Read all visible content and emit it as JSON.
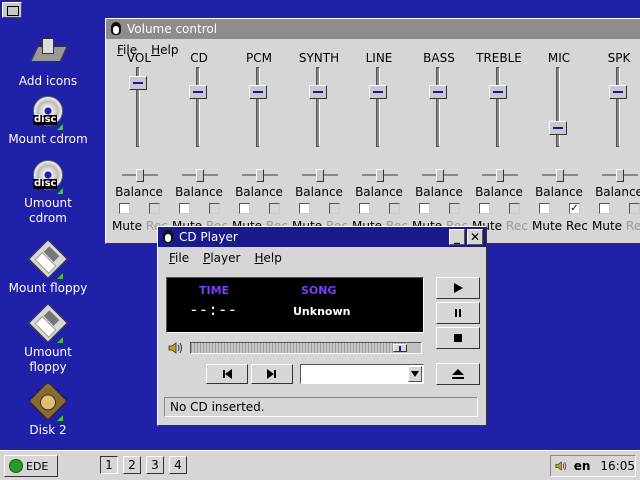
{
  "desktop": {
    "icons": [
      {
        "label": "Add icons",
        "icon": "add-icons-icon"
      },
      {
        "label": "Mount cdrom",
        "icon": "cdrom-icon"
      },
      {
        "label": "Umount\ncdrom",
        "icon": "cdrom-icon"
      },
      {
        "label": "Mount floppy",
        "icon": "floppy-icon"
      },
      {
        "label": "Umount\nfloppy",
        "icon": "floppy-icon"
      },
      {
        "label": "Disk 2",
        "icon": "disk-icon"
      }
    ],
    "cd_icon_text": "disc"
  },
  "volume": {
    "title": "Volume control",
    "menu": [
      "File",
      "Help"
    ],
    "balance_label": "Balance",
    "mute_label": "Mute",
    "rec_label": "Rec",
    "channels": [
      {
        "label": "VOL",
        "level": 0.86,
        "rec": false
      },
      {
        "label": "CD",
        "level": 0.72,
        "rec": false
      },
      {
        "label": "PCM",
        "level": 0.72,
        "rec": false
      },
      {
        "label": "SYNTH",
        "level": 0.72,
        "rec": false
      },
      {
        "label": "LINE",
        "level": 0.72,
        "rec": false
      },
      {
        "label": "BASS",
        "level": 0.72,
        "rec": false
      },
      {
        "label": "TREBLE",
        "level": 0.72,
        "rec": false
      },
      {
        "label": "MIC",
        "level": 0.18,
        "rec": true
      },
      {
        "label": "SPK",
        "level": 0.72,
        "rec": false
      }
    ]
  },
  "cdplayer": {
    "title": "CD Player",
    "menu": [
      "File",
      "Player",
      "Help"
    ],
    "time_header": "TIME",
    "song_header": "SONG",
    "time_value": "--:--",
    "song_value": "Unknown",
    "progress": 0.94,
    "status": "No CD inserted.",
    "track_value": "",
    "minimize_glyph": "_",
    "close_glyph": "✕"
  },
  "taskbar": {
    "start_label": "EDE",
    "workspaces": [
      "1",
      "2",
      "3",
      "4"
    ],
    "current_workspace": 0,
    "language": "en",
    "clock": "16:05"
  },
  "colors": {
    "desktop": "#2020a8",
    "active_title": "#1a1a8c",
    "inactive_title": "#8c8c8c",
    "display_header": "#7a3cff"
  }
}
